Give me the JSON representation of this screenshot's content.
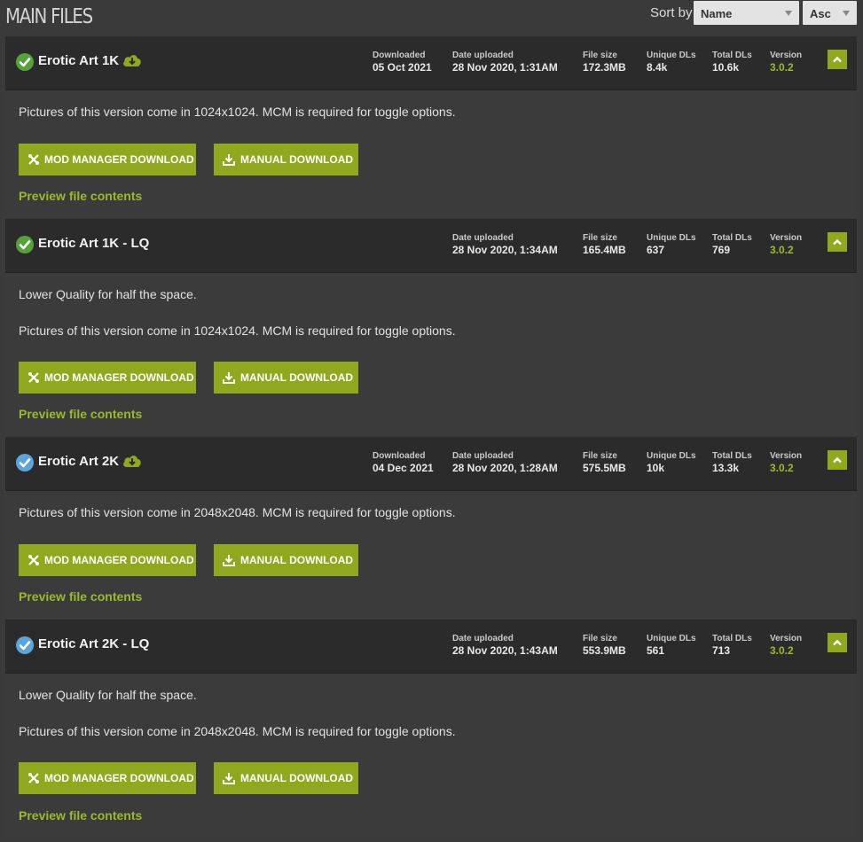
{
  "header": {
    "title": "MAIN FILES",
    "sort_label": "Sort by",
    "sort_field": "Name",
    "sort_order": "Asc"
  },
  "labels": {
    "downloaded": "Downloaded",
    "date_uploaded": "Date uploaded",
    "file_size": "File size",
    "unique_dls": "Unique DLs",
    "total_dls": "Total DLs",
    "version": "Version",
    "mod_manager_download": "MOD MANAGER DOWNLOAD",
    "manual_download": "MANUAL DOWNLOAD",
    "preview": "Preview file contents"
  },
  "colors": {
    "accent": "#8fa81d",
    "accent_text": "#9bba2b",
    "status_downloaded": "#55a23a",
    "status_installed": "#5aa5d9"
  },
  "files": [
    {
      "name": "Erotic Art 1K",
      "status_icon": "check-circle-green",
      "cloud_icon": "cloud-download-icon",
      "downloaded": "05 Oct 2021",
      "date_uploaded": "28 Nov 2020, 1:31AM",
      "file_size": "172.3MB",
      "unique_dls": "8.4k",
      "total_dls": "10.6k",
      "version": "3.0.2",
      "descriptions": [
        "Pictures of this version come in 1024x1024. MCM is required for toggle options."
      ]
    },
    {
      "name": "Erotic Art 1K - LQ",
      "status_icon": "check-circle-green",
      "date_uploaded": "28 Nov 2020, 1:34AM",
      "file_size": "165.4MB",
      "unique_dls": "637",
      "total_dls": "769",
      "version": "3.0.2",
      "descriptions": [
        "Lower Quality for half the space.",
        "Pictures of this version come in 1024x1024. MCM is required for toggle options."
      ]
    },
    {
      "name": "Erotic Art 2K",
      "status_icon": "check-circle-blue",
      "cloud_icon": "cloud-download-icon",
      "downloaded": "04 Dec 2021",
      "date_uploaded": "28 Nov 2020, 1:28AM",
      "file_size": "575.5MB",
      "unique_dls": "10k",
      "total_dls": "13.3k",
      "version": "3.0.2",
      "descriptions": [
        "Pictures of this version come in 2048x2048. MCM is required for toggle options."
      ]
    },
    {
      "name": "Erotic Art 2K - LQ",
      "status_icon": "check-circle-blue",
      "date_uploaded": "28 Nov 2020, 1:43AM",
      "file_size": "553.9MB",
      "unique_dls": "561",
      "total_dls": "713",
      "version": "3.0.2",
      "descriptions": [
        "Lower Quality for half the space.",
        "Pictures of this version come in 2048x2048. MCM is required for toggle options."
      ]
    }
  ]
}
